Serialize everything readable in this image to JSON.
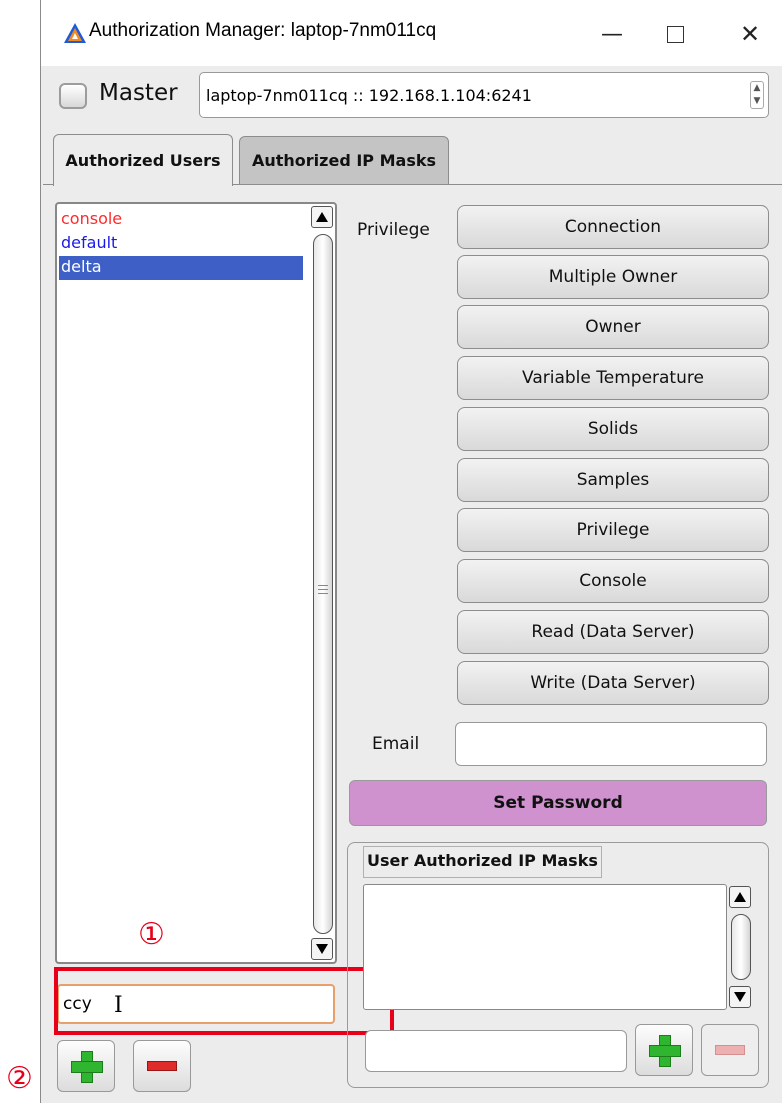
{
  "window": {
    "title": "Authorization Manager:  laptop-7nm011cq",
    "minimize_glyph": "—",
    "close_glyph": "✕"
  },
  "master": {
    "label": "Master",
    "checked": false,
    "host_value": "laptop-7nm011cq :: 192.168.1.104:6241",
    "spinner_up": "▲",
    "spinner_down": "▼"
  },
  "tabs": [
    {
      "label": "Authorized Users",
      "active": true
    },
    {
      "label": "Authorized IP Masks",
      "active": false
    }
  ],
  "users": [
    {
      "name": "console",
      "color": "#ff2a2a",
      "selected": false
    },
    {
      "name": "default",
      "color": "#1a1ae8",
      "selected": false
    },
    {
      "name": "delta",
      "color": "#ffffff",
      "selected": true,
      "selected_bg": "#3d5fc6"
    }
  ],
  "new_user": {
    "value": "ccy"
  },
  "annotations": {
    "step1": "①",
    "step2": "②",
    "highlight_color": "#e8001b"
  },
  "privilege": {
    "label": "Privilege",
    "buttons": [
      "Connection",
      "Multiple Owner",
      "Owner",
      "Variable Temperature",
      "Solids",
      "Samples",
      "Privilege",
      "Console",
      "Read (Data Server)",
      "Write (Data Server)"
    ]
  },
  "email": {
    "label": "Email",
    "value": ""
  },
  "set_password": {
    "label": "Set Password",
    "color": "#cf92cf"
  },
  "ip_masks": {
    "title": "User Authorized IP Masks",
    "input_value": ""
  },
  "icons": {
    "add": "plus-icon",
    "remove": "minus-icon",
    "scroll_up": "arrow-up-icon",
    "scroll_down": "arrow-down-icon"
  }
}
